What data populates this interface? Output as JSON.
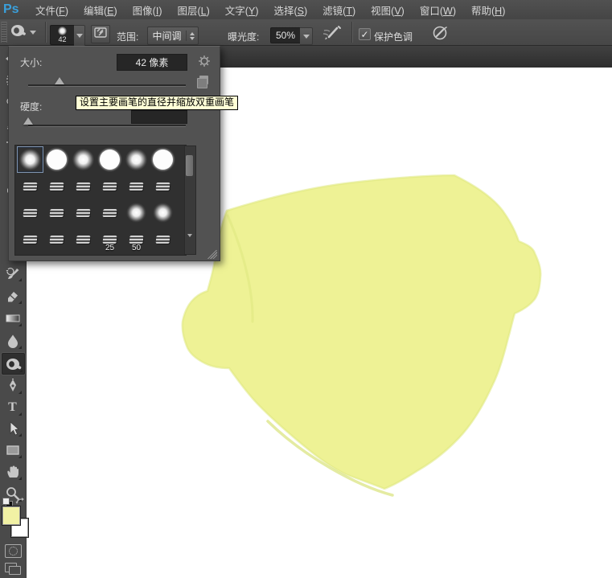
{
  "app": {
    "logo": "Ps"
  },
  "menu_bar": {
    "items": [
      "文件(F)",
      "编辑(E)",
      "图像(I)",
      "图层(L)",
      "文字(Y)",
      "选择(S)",
      "滤镜(T)",
      "视图(V)",
      "窗口(W)",
      "帮助(H)"
    ]
  },
  "options_bar": {
    "brush_size_preview": "42",
    "range_label": "范围:",
    "range_value": "中间调",
    "exposure_label": "曝光度:",
    "exposure_value": "50%",
    "protect_tones_label": "保护色调",
    "protect_tones_checked": true,
    "check_glyph": "✓"
  },
  "brush_panel": {
    "size_label": "大小:",
    "size_value": "42 像素",
    "hardness_label": "硬度:",
    "size_slider_fraction": 0.2,
    "hardness_slider_fraction": 0,
    "presets": [
      {
        "kind": "soft",
        "selected": true
      },
      {
        "kind": "hard"
      },
      {
        "kind": "soft"
      },
      {
        "kind": "hard"
      },
      {
        "kind": "soft"
      },
      {
        "kind": "hard"
      },
      {
        "kind": "tip"
      },
      {
        "kind": "tip"
      },
      {
        "kind": "tip"
      },
      {
        "kind": "tip"
      },
      {
        "kind": "tip"
      },
      {
        "kind": "tip"
      },
      {
        "kind": "tip"
      },
      {
        "kind": "tip"
      },
      {
        "kind": "tip"
      },
      {
        "kind": "tip"
      },
      {
        "kind": "soft-sm"
      },
      {
        "kind": "soft-sm"
      },
      {
        "kind": "tip"
      },
      {
        "kind": "tip"
      },
      {
        "kind": "tip"
      },
      {
        "kind": "tip",
        "label": "25"
      },
      {
        "kind": "tip",
        "label": "50"
      },
      {
        "kind": "tip"
      }
    ]
  },
  "tooltip": {
    "text": "设置主要画笔的直径并缩放双重画笔"
  },
  "toolbar": {
    "tools": [
      "move",
      "rectangular-marquee",
      "lasso",
      "quick-selection",
      "crop",
      "eyedropper",
      "spot-healing-brush",
      "brush",
      "clone-stamp",
      "history-brush",
      "eraser",
      "gradient",
      "blur",
      "burn",
      "pen",
      "type",
      "path-selection",
      "rectangle",
      "hand",
      "zoom"
    ],
    "selected_tool": "burn",
    "type_glyph": "T",
    "foreground_color": "#f1f1a4",
    "background_color": "#ffffff"
  },
  "canvas": {
    "paint_color": "#eef295"
  }
}
